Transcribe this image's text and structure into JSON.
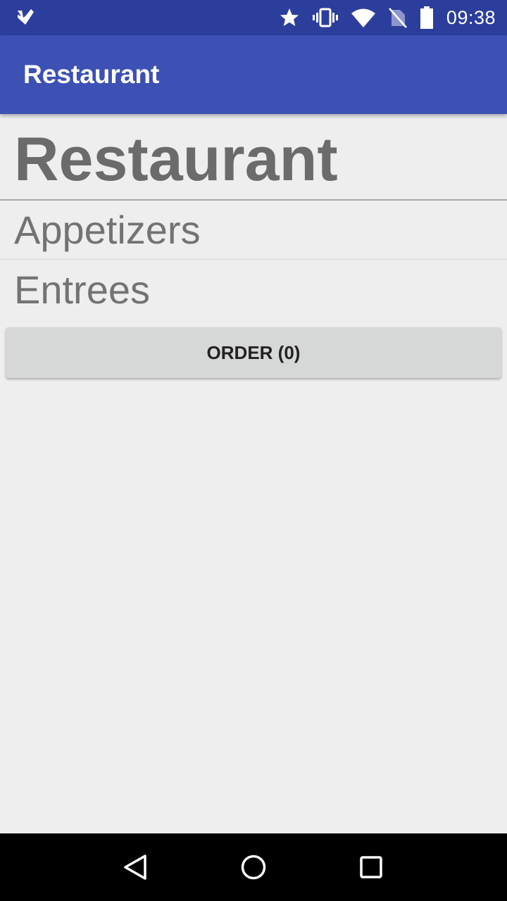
{
  "status_bar": {
    "time": "09:38",
    "icons": [
      "app-notification-icon",
      "star-icon",
      "vibrate-icon",
      "wifi-icon",
      "no-sim-icon",
      "battery-icon"
    ]
  },
  "app_bar": {
    "title": "Restaurant"
  },
  "main": {
    "heading": "Restaurant",
    "menu_items": [
      {
        "label": "Appetizers"
      },
      {
        "label": "Entrees"
      }
    ],
    "order_button_label": "ORDER (0)"
  },
  "nav_bar": {
    "icons": [
      "back-icon",
      "home-icon",
      "recents-icon"
    ]
  },
  "colors": {
    "status_bar": "#2c3e9c",
    "app_bar": "#3d50b4",
    "background": "#eeeeee",
    "button": "#d6d7d7"
  }
}
